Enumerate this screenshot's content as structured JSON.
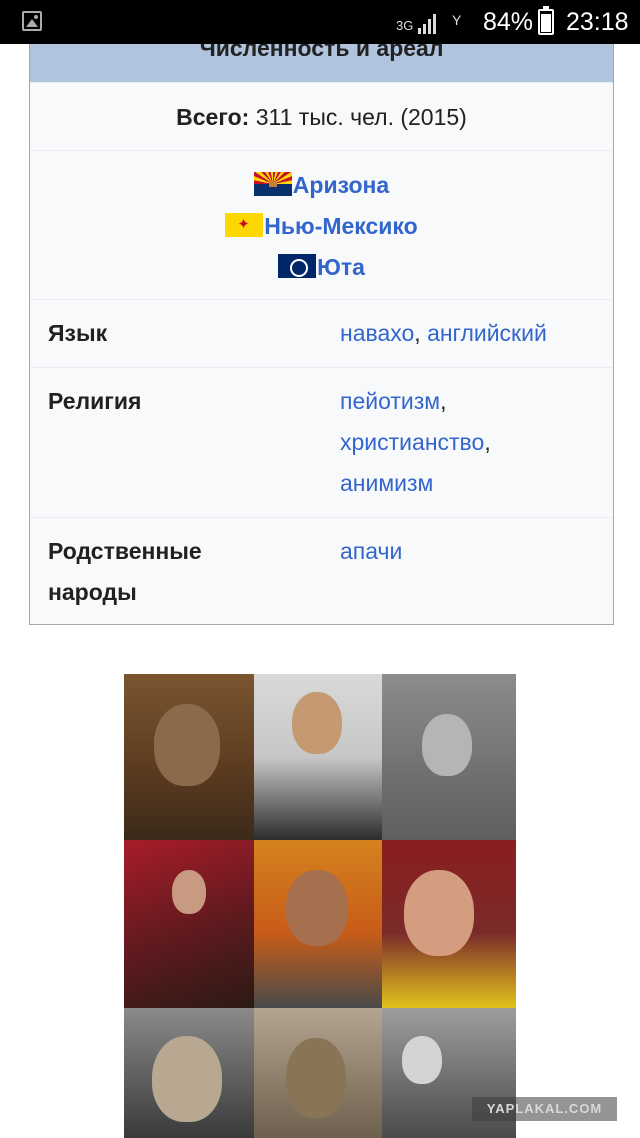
{
  "status_bar": {
    "network": "3G",
    "battery_percent": "84%",
    "battery_level": 0.84,
    "time": "23:18"
  },
  "infobox": {
    "header": "Численность и ареал",
    "total_label": "Всего:",
    "total_value": " 311 тыс. чел. (2015)",
    "regions": [
      {
        "name": "Аризона",
        "flag": "arizona-flag"
      },
      {
        "name": "Нью-Мексико",
        "flag": "new-mexico-flag"
      },
      {
        "name": "Юта",
        "flag": "utah-flag"
      }
    ],
    "language": {
      "label": "Язык",
      "values": [
        "навахо",
        "английский"
      ],
      "separator": ", "
    },
    "religion": {
      "label": "Религия",
      "values": [
        "пейотизм",
        "христианство",
        "анимизм"
      ],
      "separator": ","
    },
    "kin": {
      "label_line1": "Родственные",
      "label_line2": "народы",
      "value": "апачи"
    }
  },
  "watermark": "YAPLAKAL.COM"
}
